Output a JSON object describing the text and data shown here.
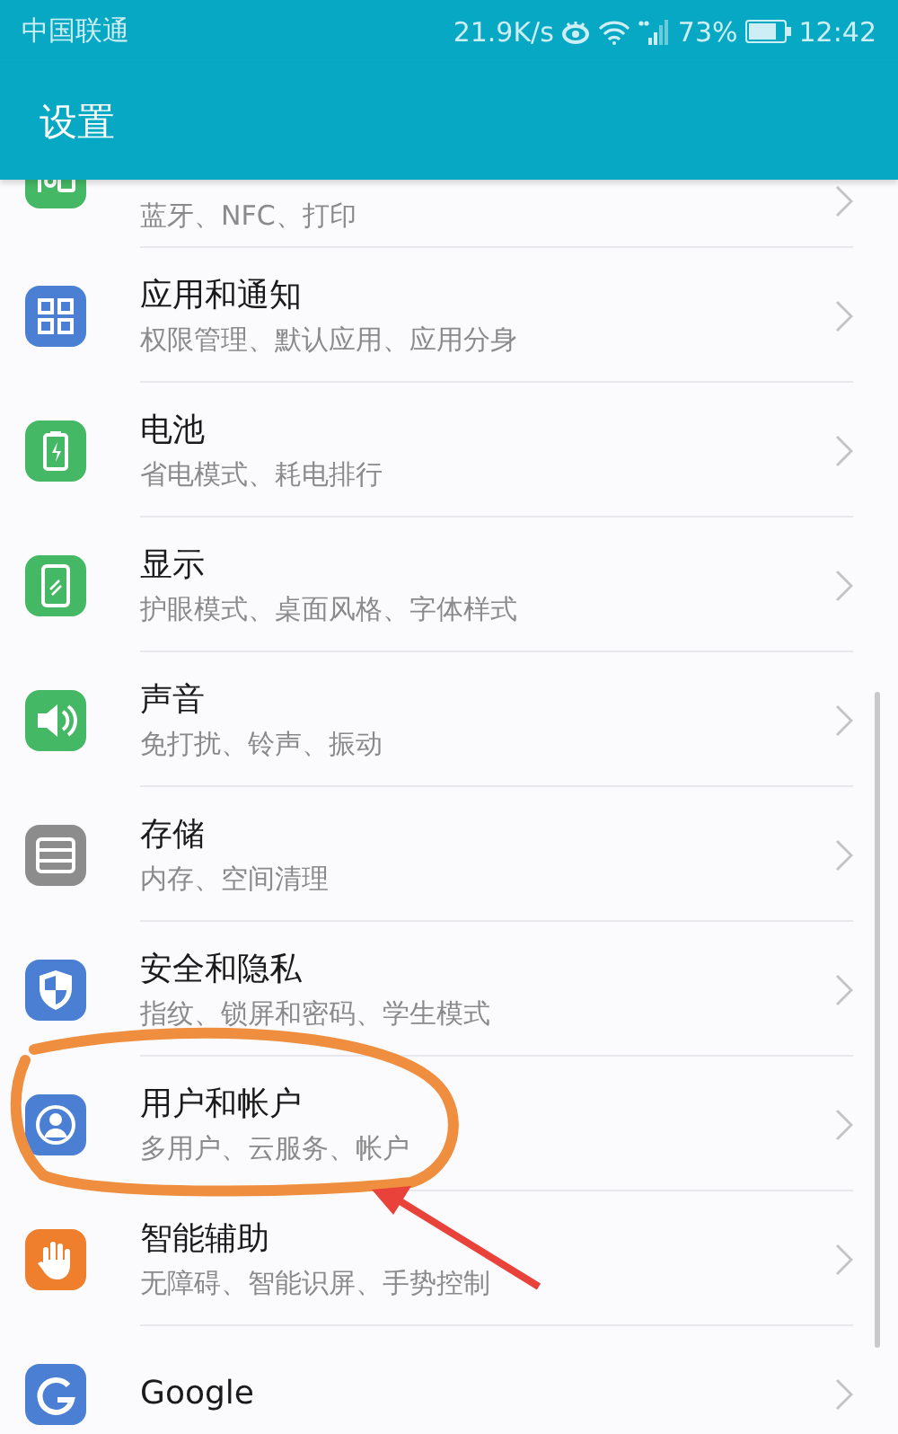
{
  "status_bar": {
    "carrier": "中国联通",
    "speed": "21.9K/s",
    "battery": "73%",
    "time": "12:42"
  },
  "header": {
    "title": "设置"
  },
  "items": [
    {
      "kind": "devices",
      "subtitle": "蓝牙、NFC、打印",
      "partial": true
    },
    {
      "kind": "apps",
      "title": "应用和通知",
      "subtitle": "权限管理、默认应用、应用分身"
    },
    {
      "kind": "battery",
      "title": "电池",
      "subtitle": "省电模式、耗电排行"
    },
    {
      "kind": "display",
      "title": "显示",
      "subtitle": "护眼模式、桌面风格、字体样式"
    },
    {
      "kind": "sound",
      "title": "声音",
      "subtitle": "免打扰、铃声、振动"
    },
    {
      "kind": "storage",
      "title": "存储",
      "subtitle": "内存、空间清理"
    },
    {
      "kind": "security",
      "title": "安全和隐私",
      "subtitle": "指纹、锁屏和密码、学生模式"
    },
    {
      "kind": "user",
      "title": "用户和帐户",
      "subtitle": "多用户、云服务、帐户"
    },
    {
      "kind": "hand",
      "title": "智能辅助",
      "subtitle": "无障碍、智能识屏、手势控制"
    },
    {
      "kind": "google",
      "title": "Google"
    }
  ]
}
